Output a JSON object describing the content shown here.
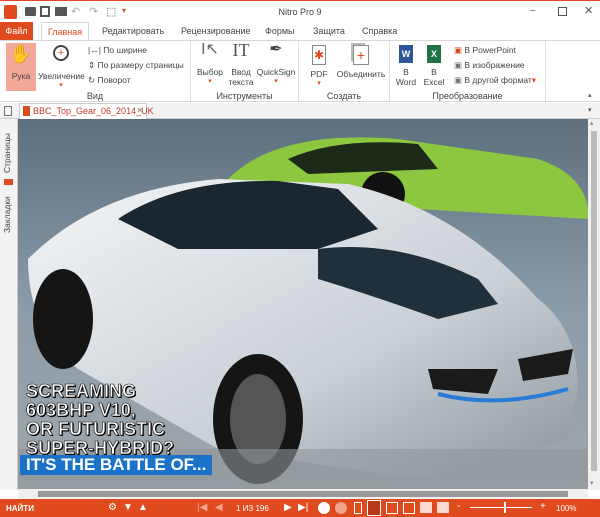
{
  "window": {
    "title": "Nitro Pro 9",
    "accent": "#e04a1f"
  },
  "menu_tabs": [
    "Файл",
    "Главная",
    "Редактировать",
    "Рецензирование",
    "Формы",
    "Защита",
    "Справка"
  ],
  "ribbon": {
    "view": {
      "label": "Вид",
      "hand": "Рука",
      "zoom": "Увеличение",
      "fit_width": "По ширине",
      "fit_page": "По размеру страницы",
      "rotate": "Поворот"
    },
    "tools": {
      "label": "Инструменты",
      "select": "Выбор",
      "type_text_1": "Ввод",
      "type_text_2": "текста",
      "quicksign": "QuickSign"
    },
    "create": {
      "label": "Создать",
      "pdf": "PDF",
      "combine": "Объединить"
    },
    "convert": {
      "label": "Преобразование",
      "word_1": "В",
      "word_2": "Word",
      "excel_1": "В",
      "excel_2": "Excel",
      "ppt": "В PowerPoint",
      "image": "В изображение",
      "other": "В другой формат"
    }
  },
  "document_tab": {
    "name": "BBC_Top_Gear_06_2014_UK"
  },
  "sidebar": {
    "pages": "Страницы",
    "bookmarks": "Закладки"
  },
  "page_content": {
    "headline": [
      "SCREAMING",
      "603BHP V10,",
      "OR FUTURISTIC",
      "SUPER-HYBRID?"
    ],
    "banner": "IT'S THE BATTLE OF..."
  },
  "status": {
    "find": "НАЙТИ",
    "page_indicator": "1 ИЗ 196",
    "zoom": "100%",
    "zoom_slider_fraction": 0.55
  }
}
